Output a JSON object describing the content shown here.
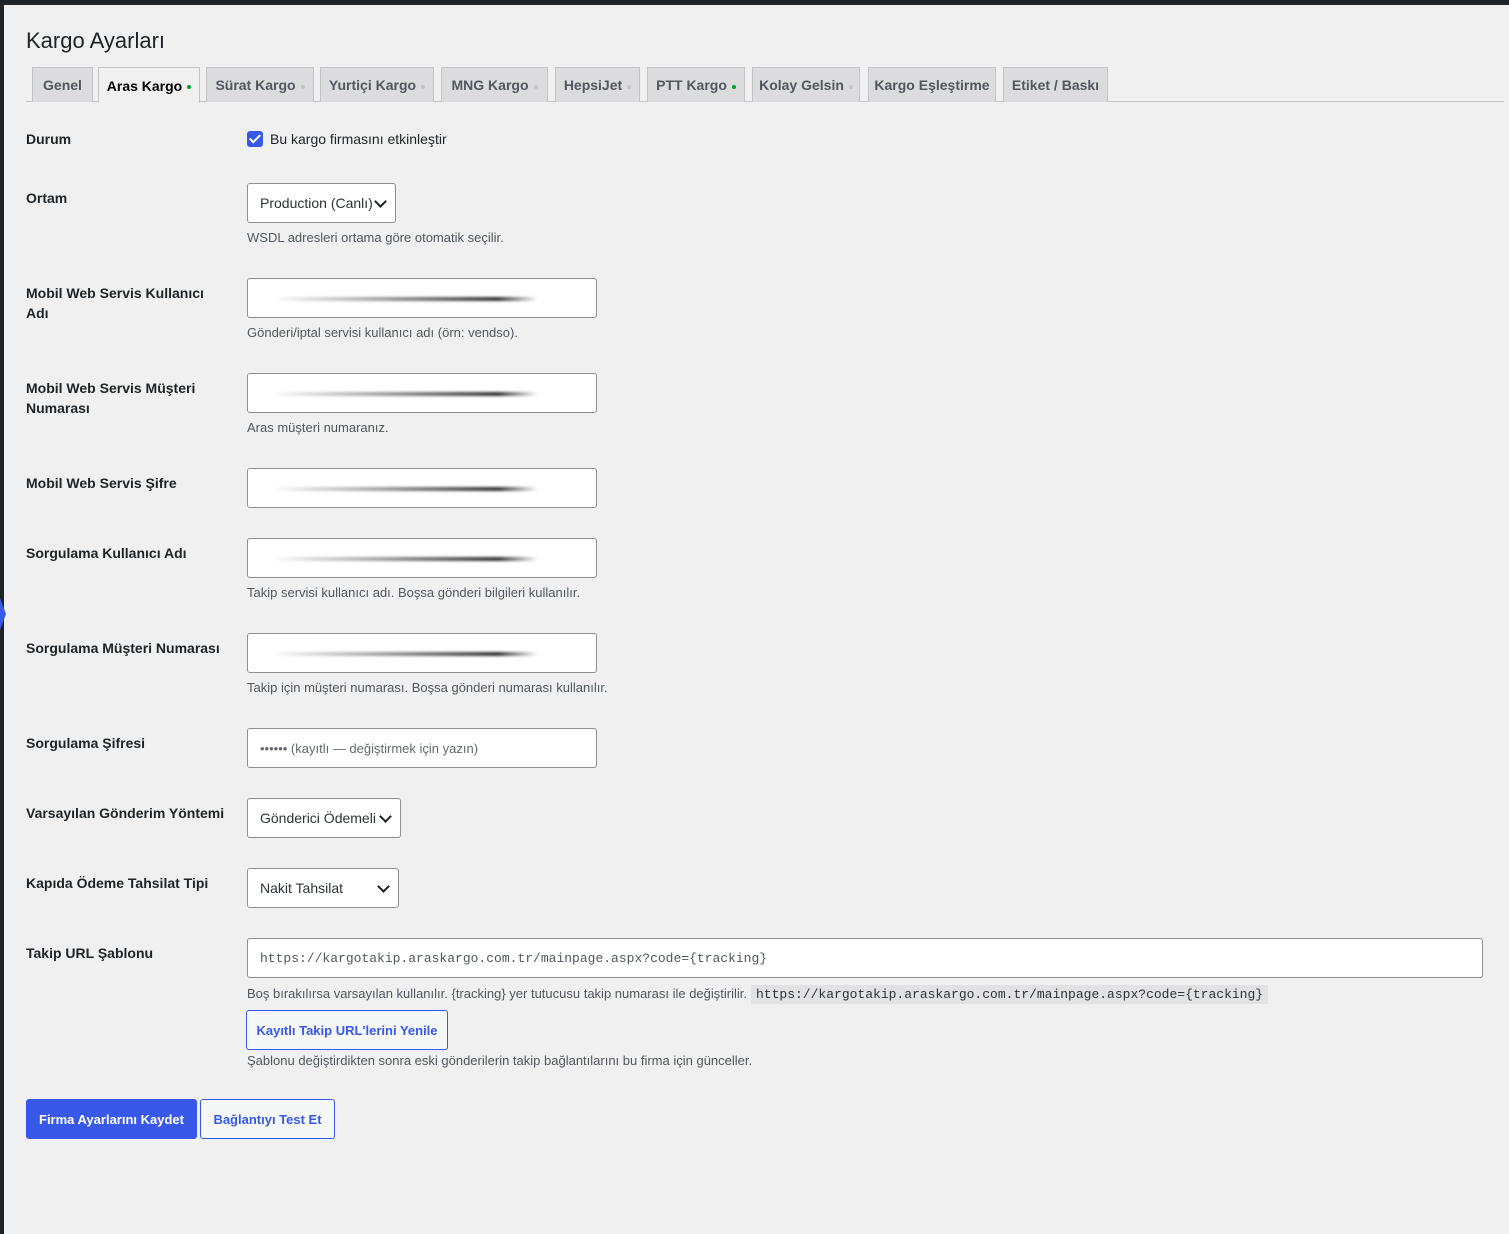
{
  "page": {
    "title": "Kargo Ayarları"
  },
  "colors": {
    "accent": "#3858e9",
    "active_dot": "#00a32a",
    "inactive_dot": "#c3c4c7"
  },
  "tabs": [
    {
      "label": "Genel",
      "active": false,
      "status": "none"
    },
    {
      "label": "Aras Kargo",
      "active": true,
      "status": "enabled"
    },
    {
      "label": "Sürat Kargo",
      "active": false,
      "status": "disabled"
    },
    {
      "label": "Yurtiçi Kargo",
      "active": false,
      "status": "disabled"
    },
    {
      "label": "MNG Kargo",
      "active": false,
      "status": "disabled"
    },
    {
      "label": "HepsiJet",
      "active": false,
      "status": "disabled"
    },
    {
      "label": "PTT Kargo",
      "active": false,
      "status": "enabled"
    },
    {
      "label": "Kolay Gelsin",
      "active": false,
      "status": "disabled"
    },
    {
      "label": "Kargo Eşleştirme",
      "active": false,
      "status": "none"
    },
    {
      "label": "Etiket / Baskı",
      "active": false,
      "status": "none"
    }
  ],
  "form": {
    "durum": {
      "label": "Durum",
      "checkbox_label": "Bu kargo firmasını etkinleştir",
      "checked": true
    },
    "ortam": {
      "label": "Ortam",
      "value": "Production (Canlı)",
      "desc": "WSDL adresleri ortama göre otomatik seçilir."
    },
    "mobil_kullanici": {
      "label": "Mobil Web Servis Kullanıcı Adı",
      "desc": "Gönderi/iptal servisi kullanıcı adı (örn: vendso)."
    },
    "mobil_musteri": {
      "label": "Mobil Web Servis Müşteri Numarası",
      "desc": "Aras müşteri numaranız."
    },
    "mobil_sifre": {
      "label": "Mobil Web Servis Şifre"
    },
    "sorgu_kullanici": {
      "label": "Sorgulama Kullanıcı Adı",
      "desc": "Takip servisi kullanıcı adı. Boşsa gönderi bilgileri kullanılır."
    },
    "sorgu_musteri": {
      "label": "Sorgulama Müşteri Numarası",
      "desc": "Takip için müşteri numarası. Boşsa gönderi numarası kullanılır."
    },
    "sorgu_sifre": {
      "label": "Sorgulama Şifresi",
      "placeholder": "•••••• (kayıtlı — değiştirmek için yazın)"
    },
    "gonderim_yontemi": {
      "label": "Varsayılan Gönderim Yöntemi",
      "value": "Gönderici Ödemeli"
    },
    "tahsilat_tipi": {
      "label": "Kapıda Ödeme Tahsilat Tipi",
      "value": "Nakit Tahsilat"
    },
    "takip_url": {
      "label": "Takip URL Şablonu",
      "value": "https://kargotakip.araskargo.com.tr/mainpage.aspx?code={tracking}",
      "desc": "Boş bırakılırsa varsayılan kullanılır. {tracking} yer tutucusu takip numarası ile değiştirilir.",
      "default_code": "https://kargotakip.araskargo.com.tr/mainpage.aspx?code={tracking}",
      "refresh_button": "Kayıtlı Takip URL'lerini Yenile",
      "refresh_desc": "Şablonu değiştirdikten sonra eski gönderilerin takip bağlantılarını bu firma için günceller."
    }
  },
  "actions": {
    "save": "Firma Ayarlarını Kaydet",
    "test": "Bağlantıyı Test Et"
  }
}
